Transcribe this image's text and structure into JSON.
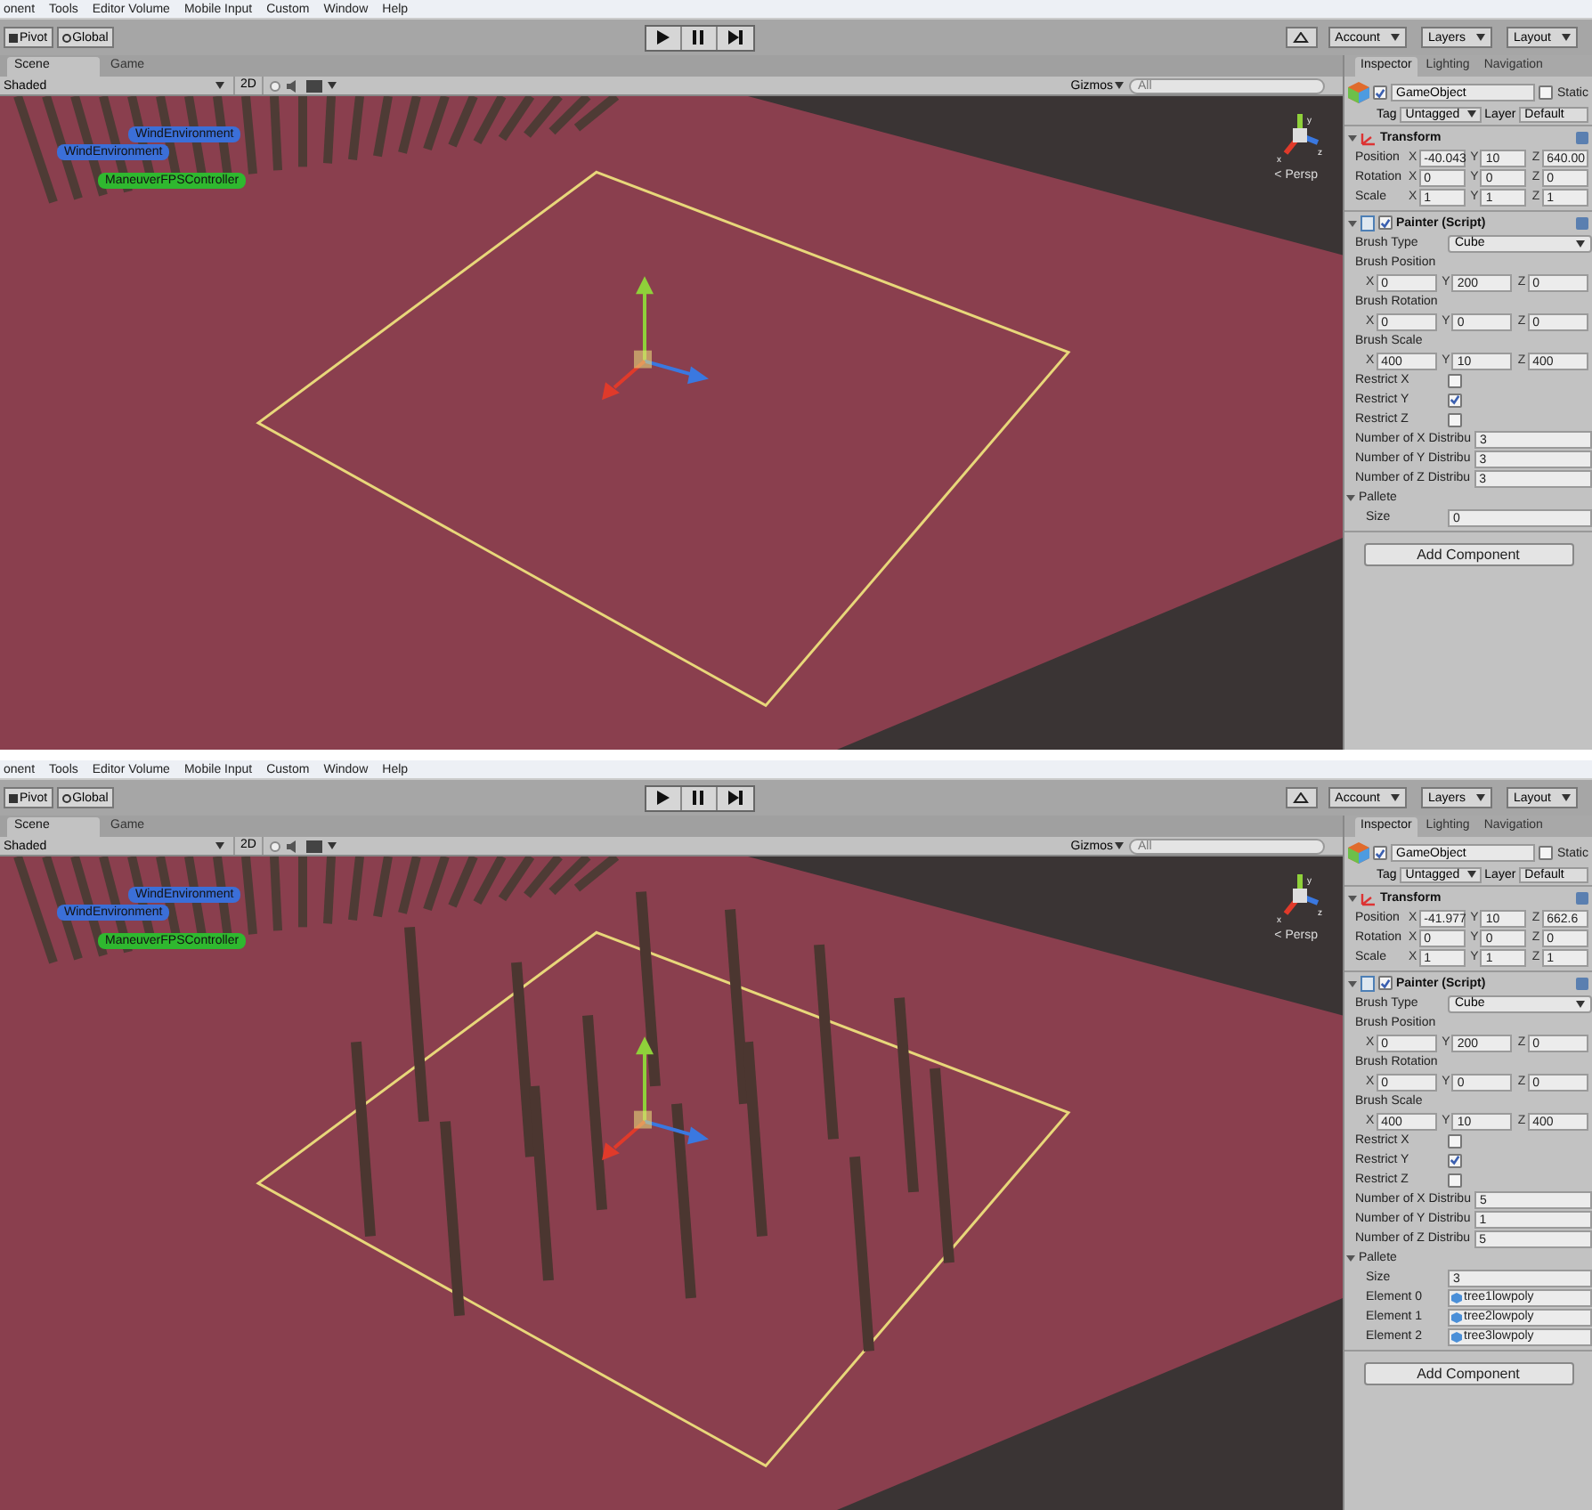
{
  "screens": [
    {
      "menu": [
        "onent",
        "Tools",
        "Editor Volume",
        "Mobile Input",
        "Custom",
        "Window",
        "Help"
      ],
      "toolbar": {
        "pivot": "Pivot",
        "global": "Global",
        "account": "Account",
        "layers": "Layers",
        "layout": "Layout"
      },
      "scene": {
        "tabs": [
          {
            "label": "Scene",
            "selected": true
          },
          {
            "label": "Game",
            "selected": false
          }
        ],
        "shading": "Shaded",
        "mode_2d": "2D",
        "gizmos": "Gizmos",
        "search_placeholder": "All",
        "painted_trees": false,
        "labels": [
          {
            "text": "WindEnvironment",
            "color": "#3b6fd8"
          },
          {
            "text": "WindEnvironment",
            "color": "#3b6fd8"
          },
          {
            "text": "ManeuverFPSController",
            "color": "#2fb82f"
          }
        ],
        "axes": [
          "y",
          "x",
          "z"
        ],
        "projection": "< Persp"
      },
      "inspector": {
        "tabs": [
          {
            "label": "Inspector",
            "selected": true
          },
          {
            "label": "Lighting",
            "selected": false
          },
          {
            "label": "Navigation",
            "selected": false
          }
        ],
        "object_name": "GameObject",
        "active": true,
        "static_label": "Static",
        "static": false,
        "tag_label": "Tag",
        "tag": "Untagged",
        "layer_label": "Layer",
        "layer": "Default",
        "components": [
          {
            "kind": "transform",
            "title": "Transform",
            "expanded": true,
            "rows": [
              {
                "label": "Position",
                "cells": [
                  {
                    "axis": "X",
                    "value": "-40.043"
                  },
                  {
                    "axis": "Y",
                    "value": "10"
                  },
                  {
                    "axis": "Z",
                    "value": "640.00"
                  }
                ]
              },
              {
                "label": "Rotation",
                "cells": [
                  {
                    "axis": "X",
                    "value": "0"
                  },
                  {
                    "axis": "Y",
                    "value": "0"
                  },
                  {
                    "axis": "Z",
                    "value": "0"
                  }
                ]
              },
              {
                "label": "Scale",
                "cells": [
                  {
                    "axis": "X",
                    "value": "1"
                  },
                  {
                    "axis": "Y",
                    "value": "1"
                  },
                  {
                    "axis": "Z",
                    "value": "1"
                  }
                ]
              }
            ]
          },
          {
            "kind": "script",
            "title": "Painter (Script)",
            "enabled": true,
            "expanded": true,
            "fields": [
              {
                "kind": "dropdown",
                "label": "Brush Type",
                "value": "Cube"
              },
              {
                "kind": "heading",
                "label": "Brush Position"
              },
              {
                "kind": "vector",
                "cells": [
                  {
                    "axis": "X",
                    "value": "0"
                  },
                  {
                    "axis": "Y",
                    "value": "200"
                  },
                  {
                    "axis": "Z",
                    "value": "0"
                  }
                ]
              },
              {
                "kind": "heading",
                "label": "Brush Rotation"
              },
              {
                "kind": "vector",
                "cells": [
                  {
                    "axis": "X",
                    "value": "0"
                  },
                  {
                    "axis": "Y",
                    "value": "0"
                  },
                  {
                    "axis": "Z",
                    "value": "0"
                  }
                ]
              },
              {
                "kind": "heading",
                "label": "Brush Scale"
              },
              {
                "kind": "vector",
                "cells": [
                  {
                    "axis": "X",
                    "value": "400"
                  },
                  {
                    "axis": "Y",
                    "value": "10"
                  },
                  {
                    "axis": "Z",
                    "value": "400"
                  }
                ]
              },
              {
                "kind": "checkbox",
                "label": "Restrict X",
                "checked": false
              },
              {
                "kind": "checkbox",
                "label": "Restrict Y",
                "checked": true
              },
              {
                "kind": "checkbox",
                "label": "Restrict Z",
                "checked": false
              },
              {
                "kind": "number",
                "label": "Number of X Distribu",
                "value": "3"
              },
              {
                "kind": "number",
                "label": "Number of Y Distribu",
                "value": "3"
              },
              {
                "kind": "number",
                "label": "Number of Z Distribu",
                "value": "3"
              },
              {
                "kind": "foldout",
                "label": "Pallete",
                "expanded": true
              },
              {
                "kind": "child-number",
                "label": "Size",
                "value": "0"
              }
            ]
          }
        ],
        "add_button": "Add Component"
      }
    },
    {
      "menu": [
        "onent",
        "Tools",
        "Editor Volume",
        "Mobile Input",
        "Custom",
        "Window",
        "Help"
      ],
      "toolbar": {
        "pivot": "Pivot",
        "global": "Global",
        "account": "Account",
        "layers": "Layers",
        "layout": "Layout"
      },
      "scene": {
        "tabs": [
          {
            "label": "Scene",
            "selected": true
          },
          {
            "label": "Game",
            "selected": false
          }
        ],
        "shading": "Shaded",
        "mode_2d": "2D",
        "gizmos": "Gizmos",
        "search_placeholder": "All",
        "painted_trees": true,
        "labels": [
          {
            "text": "WindEnvironment",
            "color": "#3b6fd8"
          },
          {
            "text": "WindEnvironment",
            "color": "#3b6fd8"
          },
          {
            "text": "ManeuverFPSController",
            "color": "#2fb82f"
          }
        ],
        "axes": [
          "y",
          "x",
          "z"
        ],
        "projection": "< Persp"
      },
      "inspector": {
        "tabs": [
          {
            "label": "Inspector",
            "selected": true
          },
          {
            "label": "Lighting",
            "selected": false
          },
          {
            "label": "Navigation",
            "selected": false
          }
        ],
        "object_name": "GameObject",
        "active": true,
        "static_label": "Static",
        "static": false,
        "tag_label": "Tag",
        "tag": "Untagged",
        "layer_label": "Layer",
        "layer": "Default",
        "components": [
          {
            "kind": "transform",
            "title": "Transform",
            "expanded": true,
            "rows": [
              {
                "label": "Position",
                "cells": [
                  {
                    "axis": "X",
                    "value": "-41.977"
                  },
                  {
                    "axis": "Y",
                    "value": "10"
                  },
                  {
                    "axis": "Z",
                    "value": "662.6"
                  }
                ]
              },
              {
                "label": "Rotation",
                "cells": [
                  {
                    "axis": "X",
                    "value": "0"
                  },
                  {
                    "axis": "Y",
                    "value": "0"
                  },
                  {
                    "axis": "Z",
                    "value": "0"
                  }
                ]
              },
              {
                "label": "Scale",
                "cells": [
                  {
                    "axis": "X",
                    "value": "1"
                  },
                  {
                    "axis": "Y",
                    "value": "1"
                  },
                  {
                    "axis": "Z",
                    "value": "1"
                  }
                ]
              }
            ]
          },
          {
            "kind": "script",
            "title": "Painter (Script)",
            "enabled": true,
            "expanded": true,
            "fields": [
              {
                "kind": "dropdown",
                "label": "Brush Type",
                "value": "Cube"
              },
              {
                "kind": "heading",
                "label": "Brush Position"
              },
              {
                "kind": "vector",
                "cells": [
                  {
                    "axis": "X",
                    "value": "0"
                  },
                  {
                    "axis": "Y",
                    "value": "200"
                  },
                  {
                    "axis": "Z",
                    "value": "0"
                  }
                ]
              },
              {
                "kind": "heading",
                "label": "Brush Rotation"
              },
              {
                "kind": "vector",
                "cells": [
                  {
                    "axis": "X",
                    "value": "0"
                  },
                  {
                    "axis": "Y",
                    "value": "0"
                  },
                  {
                    "axis": "Z",
                    "value": "0"
                  }
                ]
              },
              {
                "kind": "heading",
                "label": "Brush Scale"
              },
              {
                "kind": "vector",
                "cells": [
                  {
                    "axis": "X",
                    "value": "400"
                  },
                  {
                    "axis": "Y",
                    "value": "10"
                  },
                  {
                    "axis": "Z",
                    "value": "400"
                  }
                ]
              },
              {
                "kind": "checkbox",
                "label": "Restrict X",
                "checked": false
              },
              {
                "kind": "checkbox",
                "label": "Restrict Y",
                "checked": true
              },
              {
                "kind": "checkbox",
                "label": "Restrict Z",
                "checked": false
              },
              {
                "kind": "number",
                "label": "Number of X Distribu",
                "value": "5"
              },
              {
                "kind": "number",
                "label": "Number of Y Distribu",
                "value": "1"
              },
              {
                "kind": "number",
                "label": "Number of Z Distribu",
                "value": "5"
              },
              {
                "kind": "foldout",
                "label": "Pallete",
                "expanded": true
              },
              {
                "kind": "child-number",
                "label": "Size",
                "value": "3"
              },
              {
                "kind": "object",
                "label": "Element 0",
                "value": "tree1lowpoly"
              },
              {
                "kind": "object",
                "label": "Element 1",
                "value": "tree2lowpoly"
              },
              {
                "kind": "object",
                "label": "Element 2",
                "value": "tree3lowpoly"
              }
            ]
          }
        ],
        "add_button": "Add Component"
      }
    }
  ]
}
